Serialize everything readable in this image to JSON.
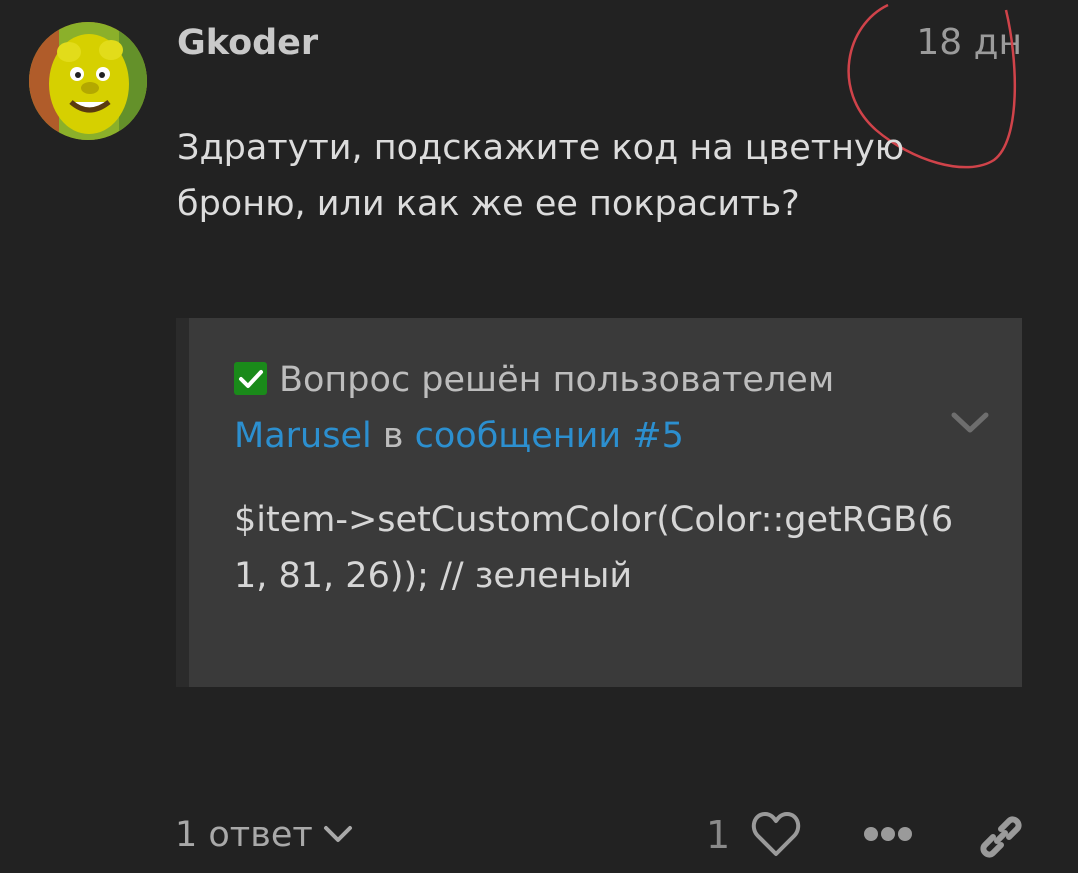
{
  "post": {
    "username": "Gkoder",
    "date": "18 дн",
    "body": "Здратути, подскажите код на цветную броню, или как же ее покрасить?"
  },
  "solution": {
    "prefix": "Вопрос решён пользователем",
    "user": "Marusel",
    "middle": "в",
    "post_link": "сообщении #5",
    "code": "$item->setCustomColor(Color::getRGB(61, 81, 26)); // зеленый"
  },
  "footer": {
    "replies_label": "1 ответ",
    "like_count": "1"
  },
  "colors": {
    "background": "#222222",
    "link": "#2c8fcf",
    "check": "#1a8a1a",
    "annotation": "#d0434a"
  }
}
